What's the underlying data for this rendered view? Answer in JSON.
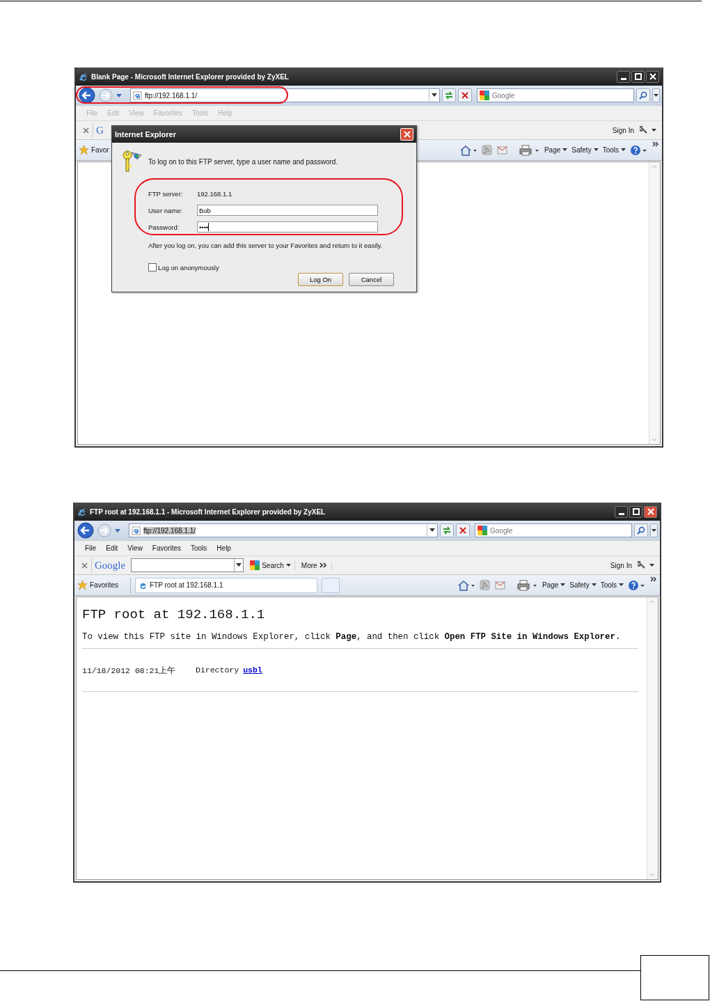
{
  "windows": [
    {
      "title": "Blank Page - Microsoft Internet Explorer provided by ZyXEL",
      "address": "ftp://192.168.1.1/",
      "address_selected": false,
      "highlight_address": true,
      "search_placeholder": "Google",
      "menu": [
        {
          "label": "File",
          "disabled": true
        },
        {
          "label": "Edit",
          "disabled": true
        },
        {
          "label": "View",
          "disabled": true
        },
        {
          "label": "Favorites",
          "disabled": true
        },
        {
          "label": "Tools",
          "disabled": true
        },
        {
          "label": "Help",
          "disabled": true
        }
      ],
      "google_toolbar": {
        "logo": "G"
      },
      "sign_in": "Sign In",
      "favorites": "Favor",
      "commands": [
        "Page",
        "Safety",
        "Tools"
      ],
      "dialog": {
        "title": "Internet Explorer",
        "message": "To log on to this FTP server, type a user name and password.",
        "server_label": "FTP server:",
        "server": "192.168.1.1",
        "user_label": "User name:",
        "user": "Bob",
        "password_label": "Password:",
        "password": "••••",
        "highlight_fields": true,
        "note": "After you log on, you can add this server to your Favorites and return to it easily.",
        "anonymous": {
          "label": "Log on anonymously",
          "checked": false
        },
        "buttons": [
          {
            "label": "Log On",
            "default": true
          },
          {
            "label": "Cancel",
            "default": false
          }
        ]
      }
    },
    {
      "title": "FTP root at 192.168.1.1 - Microsoft Internet Explorer provided by ZyXEL",
      "address": "ftp://192.168.1.1/",
      "address_selected": true,
      "highlight_address": false,
      "search_placeholder": "Google",
      "menu": [
        {
          "label": "File",
          "disabled": false
        },
        {
          "label": "Edit",
          "disabled": false
        },
        {
          "label": "View",
          "disabled": false
        },
        {
          "label": "Favorites",
          "disabled": false
        },
        {
          "label": "Tools",
          "disabled": false
        },
        {
          "label": "Help",
          "disabled": false
        }
      ],
      "google_toolbar": {
        "logo": "Google",
        "search": "Search",
        "more": "More"
      },
      "sign_in": "Sign In",
      "favorites": "Favorites",
      "tab": "FTP root at 192.168.1.1",
      "commands": [
        "Page",
        "Safety",
        "Tools"
      ],
      "content": {
        "heading": "FTP root at 192.168.1.1",
        "instructions": "To view this FTP site in Windows Explorer, click **Page**, and then click **Open FTP Site in Windows Explorer**.",
        "entries": [
          {
            "date": "11/18/2012 08:21上午",
            "type": "Directory",
            "name": "usbl"
          }
        ]
      }
    }
  ]
}
